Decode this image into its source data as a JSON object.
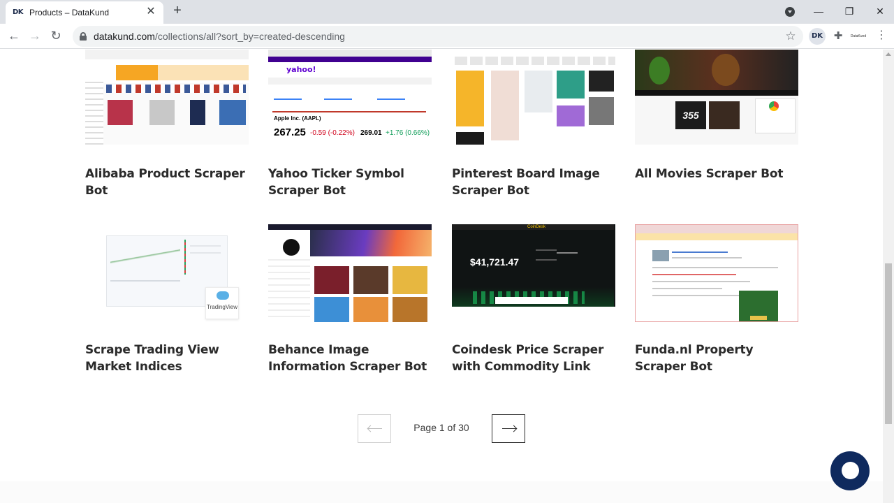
{
  "browser": {
    "tab_favicon": "DK",
    "tab_title": "Products – DataKund",
    "tab_close": "✕",
    "new_tab": "+",
    "url_domain": "datakund.com",
    "url_path": "/collections/all?sort_by=created-descending",
    "extension_label": "DK",
    "profile_label": "DataKund",
    "window_minimize": "—",
    "window_restore": "❐",
    "window_close": "✕",
    "back": "←",
    "forward": "→",
    "reload": "↻",
    "menu": "⋮",
    "bookmark": "☆",
    "extensions": "✚"
  },
  "products": [
    {
      "title": "Alibaba Product Scraper Bot",
      "icon": "alibaba-screenshot"
    },
    {
      "title": "Yahoo Ticker Symbol Scraper Bot",
      "icon": "yahoo-finance-screenshot"
    },
    {
      "title": "Pinterest Board Image Scraper Bot",
      "icon": "pinterest-screenshot"
    },
    {
      "title": "All Movies Scraper Bot",
      "icon": "movies-screenshot"
    },
    {
      "title": "Scrape Trading View Market Indices",
      "icon": "tradingview-screenshot"
    },
    {
      "title": "Behance Image Information Scraper Bot",
      "icon": "behance-screenshot"
    },
    {
      "title": "Coindesk Price Scraper with Commodity Link",
      "icon": "coindesk-screenshot"
    },
    {
      "title": "Funda.nl Property Scraper Bot",
      "icon": "funda-screenshot"
    }
  ],
  "thumb_text": {
    "yahoo_logo": "yahoo!",
    "yahoo_company": "Apple Inc. (AAPL)",
    "yahoo_price": "267.25",
    "yahoo_change": "-0.59 (-0.22%)",
    "yahoo_price2": "269.01",
    "yahoo_change2": "+1.76 (0.66%)",
    "movies_badge": "355",
    "tradingview_logo": "TradingView",
    "coindesk_brand": "CoinDesk",
    "coindesk_price": "$41,721.47"
  },
  "pagination": {
    "label": "Page 1 of 30",
    "prev": "previous-arrow-icon",
    "next": "next-arrow-icon"
  },
  "colors": {
    "accent": "#0f2a5e",
    "title_text": "#2b2b2b"
  }
}
